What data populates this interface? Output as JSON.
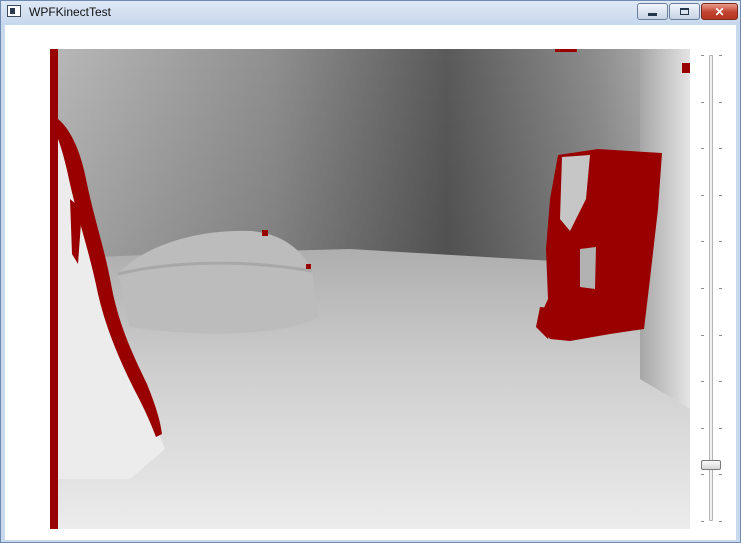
{
  "window": {
    "title": "WPFKinectTest",
    "minimize_label": "",
    "maximize_label": "",
    "close_label": "✕"
  },
  "depth_view": {
    "content": "kinect-depth-image",
    "highlight_color": "#990000"
  },
  "slider": {
    "value_fraction": 0.12,
    "tick_count": 11
  }
}
